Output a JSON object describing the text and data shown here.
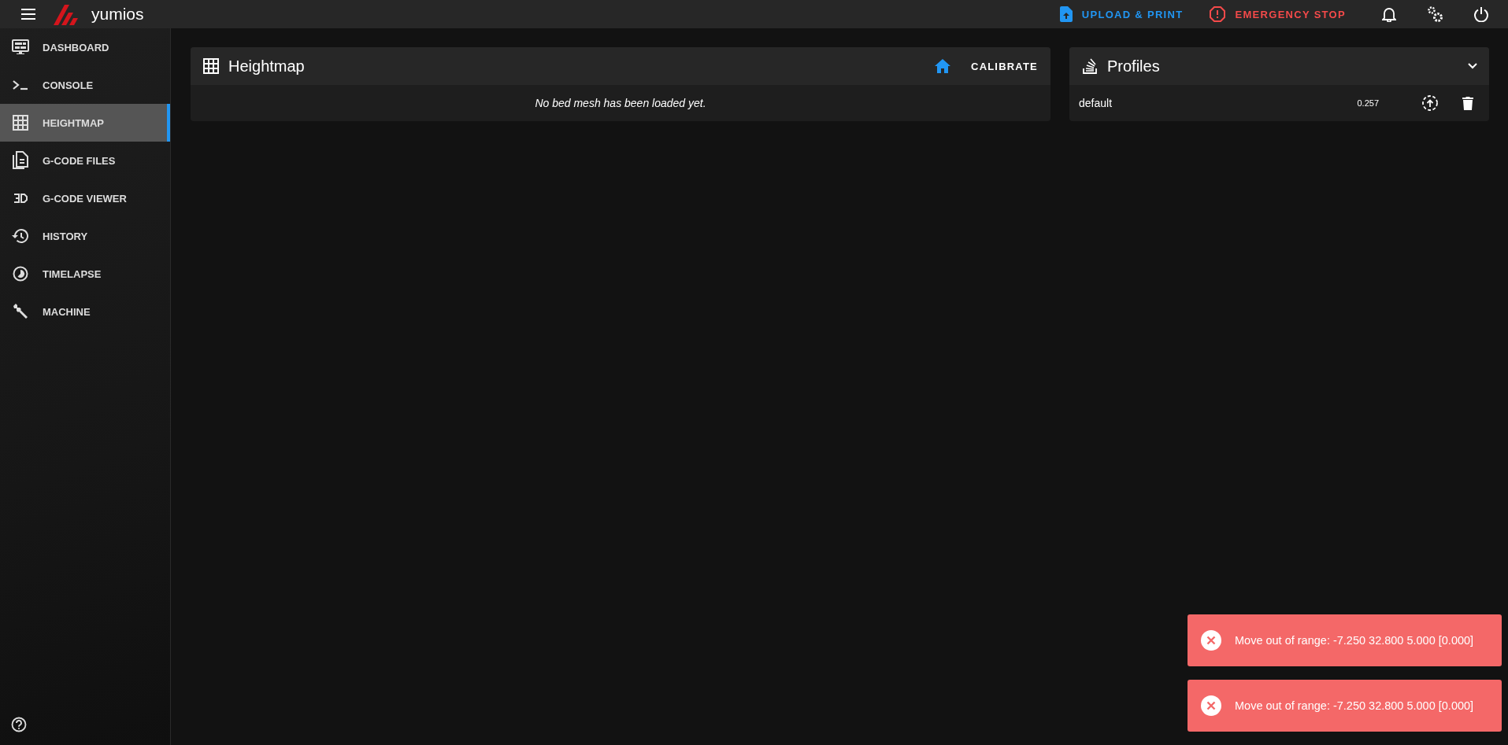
{
  "app_bar": {
    "brand": "yumios",
    "upload_button": "UPLOAD & PRINT",
    "emergency_button": "EMERGENCY STOP"
  },
  "sidebar": {
    "items": [
      {
        "label": "DASHBOARD",
        "kind": "dashboard",
        "selected": false
      },
      {
        "label": "CONSOLE",
        "kind": "console",
        "selected": false
      },
      {
        "label": "HEIGHTMAP",
        "kind": "grid",
        "selected": true
      },
      {
        "label": "G-CODE FILES",
        "kind": "files",
        "selected": false
      },
      {
        "label": "G-CODE VIEWER",
        "kind": "viewer",
        "selected": false
      },
      {
        "label": "HISTORY",
        "kind": "history",
        "selected": false
      },
      {
        "label": "TIMELAPSE",
        "kind": "timelapse",
        "selected": false
      },
      {
        "label": "MACHINE",
        "kind": "machine",
        "selected": false
      }
    ]
  },
  "heightmap_panel": {
    "title": "Heightmap",
    "calibrate_button": "CALIBRATE",
    "message": "No bed mesh has been loaded yet."
  },
  "profiles_panel": {
    "title": "Profiles",
    "expanded": true,
    "rows": [
      {
        "name": "default",
        "value": "0.257"
      }
    ]
  },
  "notifications": [
    {
      "message": "Move out of range: -7.250 32.800 5.000 [0.000]"
    },
    {
      "message": "Move out of range: -7.250 32.800 5.000 [0.000]"
    }
  ]
}
